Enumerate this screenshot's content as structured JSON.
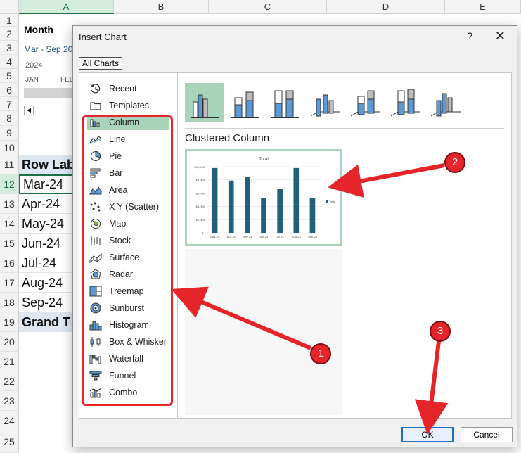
{
  "spreadsheet": {
    "columns": [
      "A",
      "B",
      "C",
      "D",
      "E"
    ],
    "rows": [
      "1",
      "2",
      "3",
      "4",
      "5",
      "6",
      "7",
      "8",
      "9",
      "10",
      "11",
      "12",
      "13",
      "14",
      "15",
      "16",
      "17",
      "18",
      "19",
      "20",
      "21",
      "22",
      "23",
      "24",
      "25"
    ],
    "slicer": {
      "title": "Month",
      "range": "Mar - Sep 20",
      "year": "2024",
      "months": [
        "JAN",
        "FEE"
      ]
    },
    "cells": {
      "row_labels_header": "Row Lab",
      "mar": "Mar-24",
      "apr": "Apr-24",
      "may": "May-24",
      "jun": "Jun-24",
      "jul": "Jul-24",
      "aug": "Aug-24",
      "sep": "Sep-24",
      "grand_total": "Grand T"
    }
  },
  "dialog": {
    "title": "Insert Chart",
    "help": "?",
    "close": "✕",
    "tab": "All Charts",
    "chart_types": [
      {
        "label": "Recent",
        "icon": "recent-icon"
      },
      {
        "label": "Templates",
        "icon": "templates-icon"
      },
      {
        "label": "Column",
        "icon": "column-chart-icon"
      },
      {
        "label": "Line",
        "icon": "line-chart-icon"
      },
      {
        "label": "Pie",
        "icon": "pie-chart-icon"
      },
      {
        "label": "Bar",
        "icon": "bar-chart-icon"
      },
      {
        "label": "Area",
        "icon": "area-chart-icon"
      },
      {
        "label": "X Y (Scatter)",
        "icon": "scatter-chart-icon"
      },
      {
        "label": "Map",
        "icon": "map-chart-icon"
      },
      {
        "label": "Stock",
        "icon": "stock-chart-icon"
      },
      {
        "label": "Surface",
        "icon": "surface-chart-icon"
      },
      {
        "label": "Radar",
        "icon": "radar-chart-icon"
      },
      {
        "label": "Treemap",
        "icon": "treemap-chart-icon"
      },
      {
        "label": "Sunburst",
        "icon": "sunburst-chart-icon"
      },
      {
        "label": "Histogram",
        "icon": "histogram-chart-icon"
      },
      {
        "label": "Box & Whisker",
        "icon": "box-whisker-chart-icon"
      },
      {
        "label": "Waterfall",
        "icon": "waterfall-chart-icon"
      },
      {
        "label": "Funnel",
        "icon": "funnel-chart-icon"
      },
      {
        "label": "Combo",
        "icon": "combo-chart-icon"
      }
    ],
    "selected_type": "Column",
    "subtype_title": "Clustered Column",
    "subtype_icons": [
      "clustered-column-icon",
      "stacked-column-icon",
      "100-stacked-column-icon",
      "3d-clustered-column-icon",
      "3d-stacked-column-icon",
      "3d-100-stacked-column-icon",
      "3d-column-icon"
    ],
    "ok_label": "OK",
    "cancel_label": "Cancel",
    "accent": "#a9d4b9"
  },
  "chart_data": {
    "type": "bar",
    "title": "Total",
    "categories": [
      "Mar-24",
      "Apr-24",
      "May-24",
      "Jun-24",
      "Jul-24",
      "Aug-24",
      "Sep-24"
    ],
    "series": [
      {
        "name": "Total",
        "values": [
          9800,
          7900,
          8400,
          5300,
          6600,
          9800,
          5300
        ]
      }
    ],
    "ytick_labels": [
      "$10,000",
      "$8,000",
      "$6,000",
      "$4,000",
      "$2,000",
      "$-"
    ],
    "ylim": [
      0,
      10000
    ],
    "legend": "right",
    "bar_color": "#1f5f7f"
  },
  "annotations": {
    "badge1": "1",
    "badge2": "2",
    "badge3": "3",
    "color": "#e5252a"
  }
}
